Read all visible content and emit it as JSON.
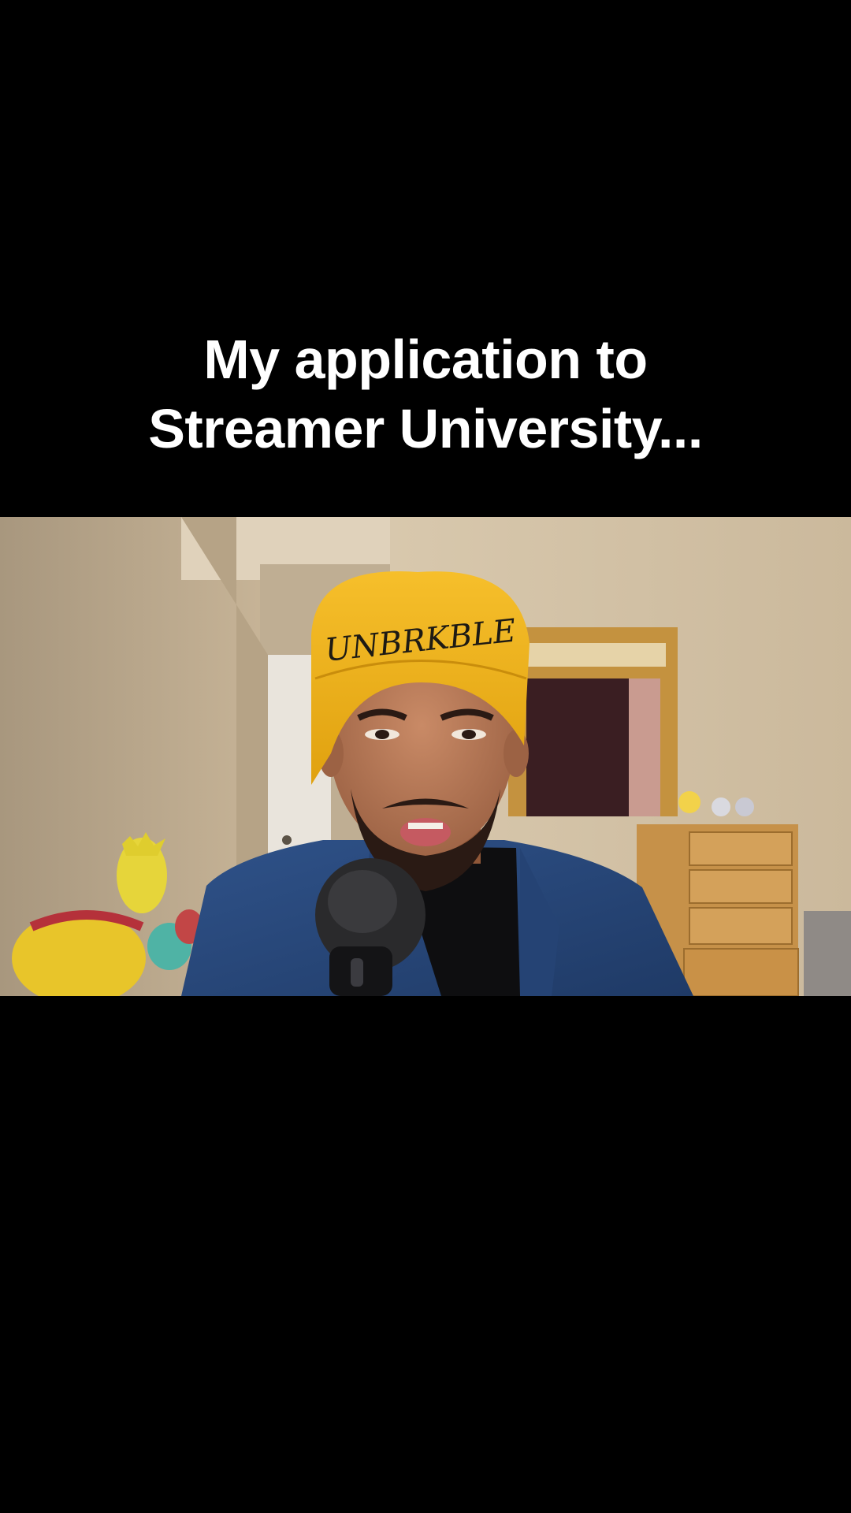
{
  "caption": {
    "line1": "My application to",
    "line2": "Streamer University..."
  },
  "video": {
    "beanie_text": "UNBRKBLE"
  },
  "colors": {
    "background": "#000000",
    "caption_text": "#ffffff",
    "beanie": "#f1b21c",
    "blazer": "#28477a",
    "wall": "#c9b79d"
  }
}
